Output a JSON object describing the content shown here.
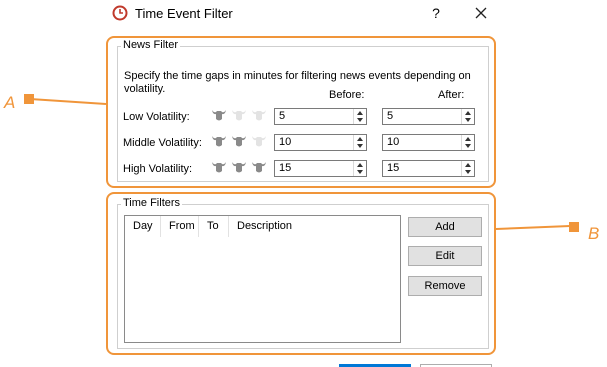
{
  "window": {
    "title": "Time Event Filter",
    "help_label": "?",
    "close_icon": "close-icon",
    "app_icon": "clock-icon"
  },
  "callouts": {
    "a_label": "A",
    "b_label": "B",
    "color": "#f0953a"
  },
  "news_filter": {
    "group_label": "News Filter",
    "description": "Specify the time gaps in minutes for filtering news events depending on volatility.",
    "before_header": "Before:",
    "after_header": "After:",
    "rows": [
      {
        "label": "Low Volatility:",
        "bulls_active": 1,
        "before": "5",
        "after": "5"
      },
      {
        "label": "Middle Volatility:",
        "bulls_active": 2,
        "before": "10",
        "after": "10"
      },
      {
        "label": "High Volatility:",
        "bulls_active": 3,
        "before": "15",
        "after": "15"
      }
    ],
    "bull_icon": "bull-icon"
  },
  "time_filters": {
    "group_label": "Time Filters",
    "columns": [
      "Day",
      "From",
      "To",
      "Description"
    ],
    "buttons": {
      "add": "Add",
      "edit": "Edit",
      "remove": "Remove"
    }
  },
  "colors": {
    "accent": "#0078d7",
    "bull_active": "#8a8a8a",
    "bull_inactive": "#e3e3e3"
  }
}
